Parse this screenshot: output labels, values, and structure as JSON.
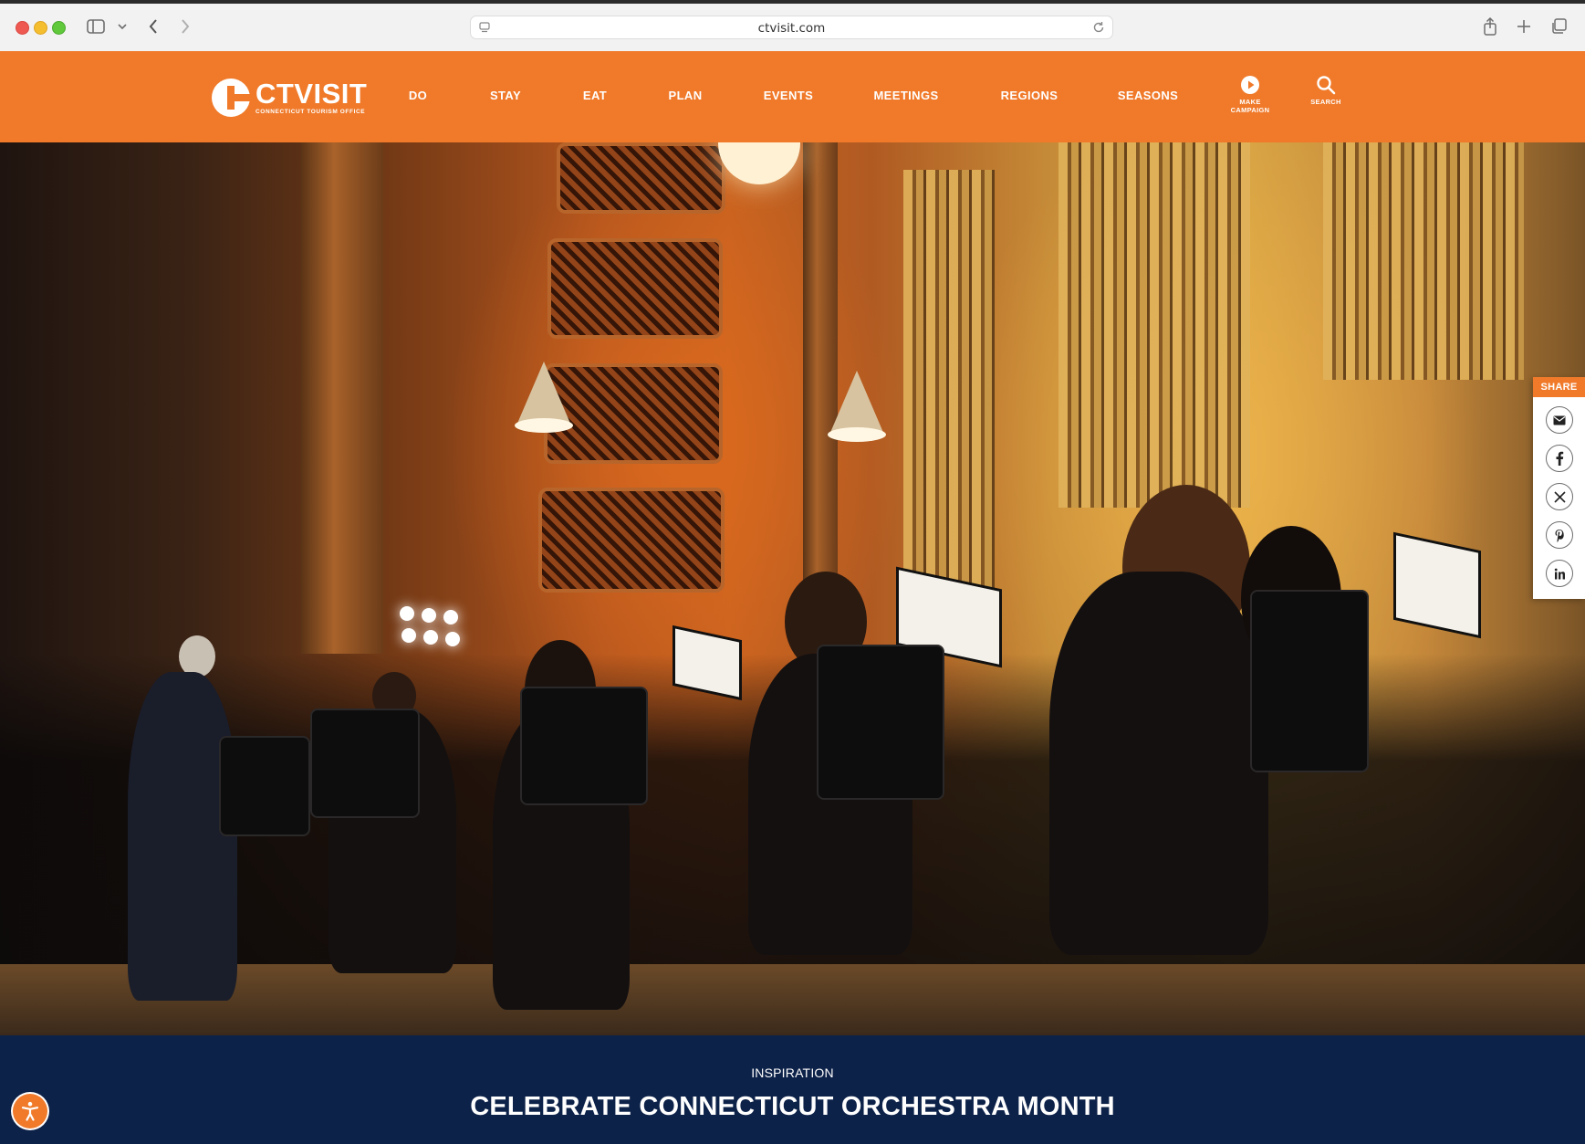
{
  "browser": {
    "url": "ctvisit.com",
    "icons": [
      "sidebar-icon",
      "chevron-down-icon",
      "back-icon",
      "forward-icon",
      "site-settings-icon",
      "reload-icon",
      "share-icon",
      "new-tab-icon",
      "tabs-overview-icon"
    ]
  },
  "header": {
    "logo_word": "CTVISIT",
    "logo_sub": "CONNECTICUT TOURISM OFFICE",
    "nav": [
      "DO",
      "STAY",
      "EAT",
      "PLAN",
      "EVENTS",
      "MEETINGS",
      "REGIONS",
      "SEASONS"
    ],
    "campaign_label": "MAKE CAMPAIGN",
    "search_label": "SEARCH",
    "accent_color": "#f07a2a"
  },
  "share": {
    "label": "SHARE",
    "buttons": [
      "email-icon",
      "facebook-icon",
      "x-icon",
      "pinterest-icon",
      "linkedin-icon"
    ]
  },
  "hero": {
    "image": "orchestra-concert-hall-photo"
  },
  "article": {
    "kicker": "INSPIRATION",
    "title": "CELEBRATE CONNECTICUT ORCHESTRA MONTH",
    "band_color": "#0d2249"
  },
  "accessibility": {
    "icon": "accessibility-icon"
  }
}
